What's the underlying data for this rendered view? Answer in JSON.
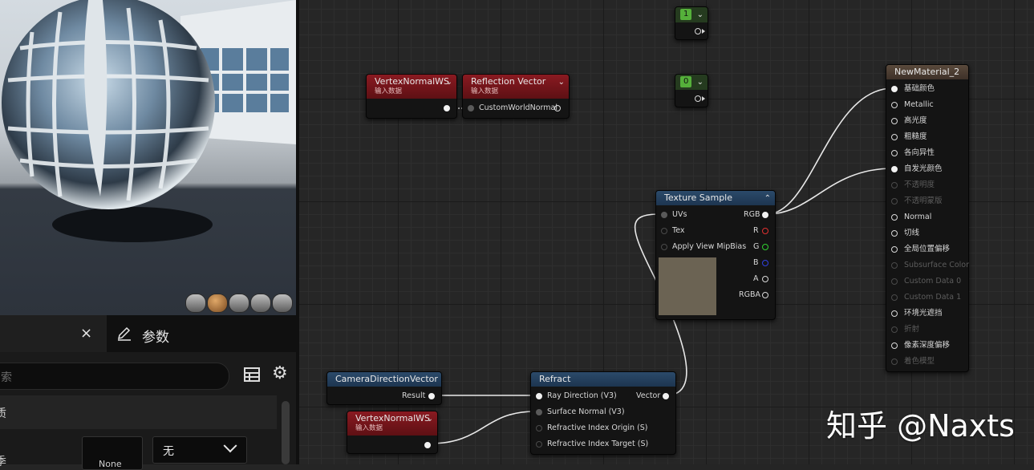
{
  "details": {
    "close_label": "×",
    "tab_label": "参数",
    "row_label_1": "质",
    "row_label_2": "季",
    "dropdown_value": "无",
    "none_button": "None",
    "search_placeholder": "索"
  },
  "nodes": {
    "const1": {
      "value": "1"
    },
    "const0": {
      "value": "0"
    },
    "vnws_top": {
      "title": "VertexNormalWS",
      "subtitle": "输入数据"
    },
    "reflection": {
      "title": "Reflection Vector",
      "subtitle": "输入数据",
      "input": "CustomWorldNormal"
    },
    "texture": {
      "title": "Texture Sample",
      "inputs": [
        "UVs",
        "Tex",
        "Apply View MipBias"
      ],
      "outputs": [
        "RGB",
        "R",
        "G",
        "B",
        "A",
        "RGBA"
      ]
    },
    "material": {
      "title": "NewMaterial_2",
      "pins": [
        {
          "label": "基础颜色",
          "enabled": true,
          "connected": true
        },
        {
          "label": "Metallic",
          "enabled": true
        },
        {
          "label": "高光度",
          "enabled": true
        },
        {
          "label": "粗糙度",
          "enabled": true
        },
        {
          "label": "各向异性",
          "enabled": true
        },
        {
          "label": "自发光颜色",
          "enabled": true,
          "connected": true
        },
        {
          "label": "不透明度",
          "enabled": false
        },
        {
          "label": "不透明蒙版",
          "enabled": false
        },
        {
          "label": "Normal",
          "enabled": true
        },
        {
          "label": "切线",
          "enabled": true
        },
        {
          "label": "全局位置偏移",
          "enabled": true
        },
        {
          "label": "Subsurface Color",
          "enabled": false
        },
        {
          "label": "Custom Data 0",
          "enabled": false
        },
        {
          "label": "Custom Data 1",
          "enabled": false
        },
        {
          "label": "环境光遮挡",
          "enabled": true
        },
        {
          "label": "折射",
          "enabled": false
        },
        {
          "label": "像素深度偏移",
          "enabled": true
        },
        {
          "label": "着色模型",
          "enabled": false
        }
      ]
    },
    "camera": {
      "title": "CameraDirectionVector",
      "output": "Result"
    },
    "vnws_bottom": {
      "title": "VertexNormalWS",
      "subtitle": "输入数据"
    },
    "refract": {
      "title": "Refract",
      "inputs": [
        "Ray Direction (V3)",
        "Surface Normal (V3)",
        "Refractive Index Origin (S)",
        "Refractive Index Target (S)"
      ],
      "output": "Vector"
    }
  },
  "watermark": "知乎 @Naxts",
  "colors": {
    "red_header": "#8a1a21",
    "blue_header": "#2b4a6a",
    "brown_header": "#5a4a3c",
    "texture_preview": "#6b6353"
  }
}
